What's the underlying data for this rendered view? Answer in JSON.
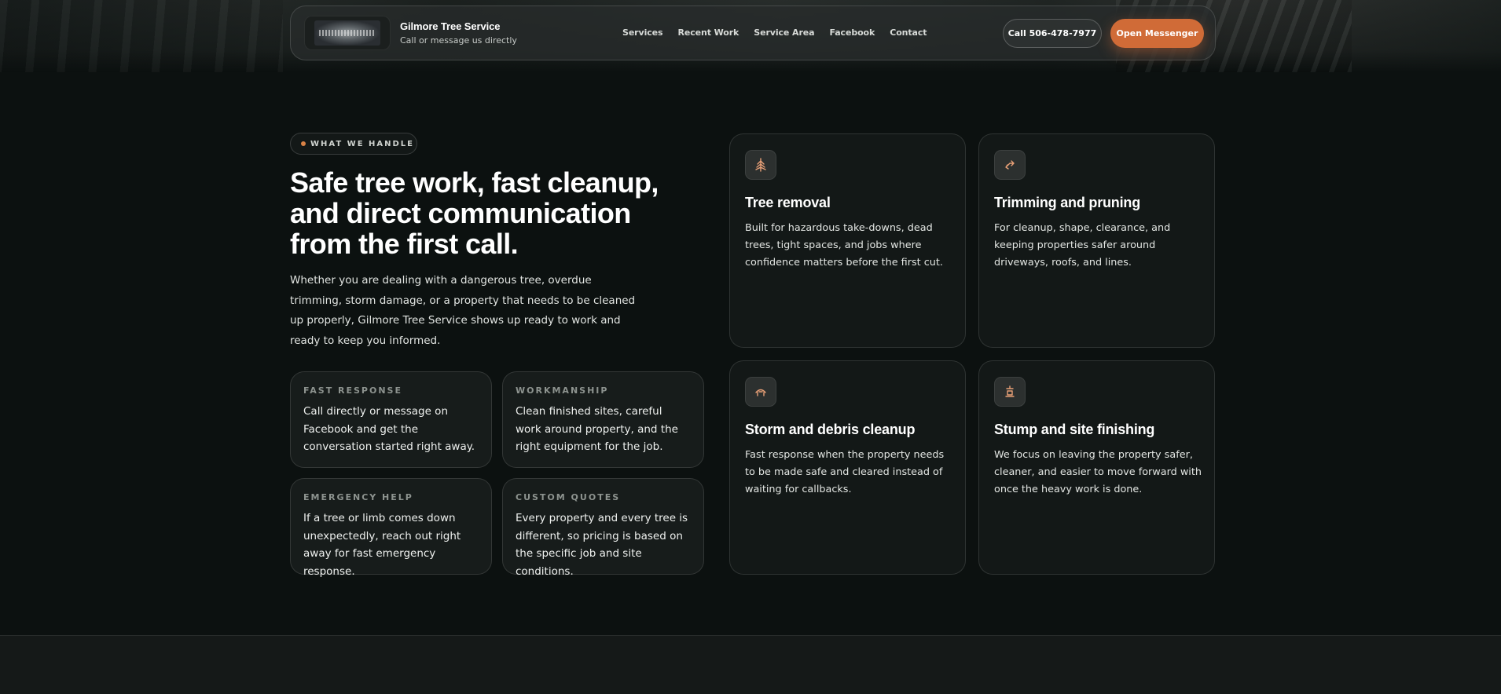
{
  "header": {
    "brand_name": "Gilmore Tree Service",
    "brand_subtitle": "Call or message us directly",
    "nav": [
      "Services",
      "Recent Work",
      "Service Area",
      "Facebook",
      "Contact"
    ],
    "call_button": "Call 506-478-7977",
    "messenger_button": "Open Messenger"
  },
  "section": {
    "eyebrow": "WHAT WE HANDLE",
    "headline": "Safe tree work, fast cleanup, and direct communication from the first call.",
    "lede": "Whether you are dealing with a dangerous tree, overdue trimming, storm damage, or a property that needs to be cleaned up properly, Gilmore Tree Service shows up ready to work and ready to keep you informed."
  },
  "features": [
    {
      "label": "FAST RESPONSE",
      "text": "Call directly or message on Facebook and get the conversation started right away."
    },
    {
      "label": "WORKMANSHIP",
      "text": "Clean finished sites, careful work around property, and the right equipment for the job."
    },
    {
      "label": "EMERGENCY HELP",
      "text": "If a tree or limb comes down unexpectedly, reach out right away for fast emergency response."
    },
    {
      "label": "CUSTOM QUOTES",
      "text": "Every property and every tree is different, so pricing is based on the specific job and site conditions."
    }
  ],
  "services": [
    {
      "icon": "tree-icon",
      "title": "Tree removal",
      "text": "Built for hazardous take-downs, dead trees, tight spaces, and jobs where confidence matters before the first cut."
    },
    {
      "icon": "pruning-icon",
      "title": "Trimming and pruning",
      "text": "For cleanup, shape, clearance, and keeping properties safer around driveways, roofs, and lines."
    },
    {
      "icon": "storm-icon",
      "title": "Storm and debris cleanup",
      "text": "Fast response when the property needs to be made safe and cleared instead of waiting for callbacks."
    },
    {
      "icon": "stump-icon",
      "title": "Stump and site finishing",
      "text": "We focus on leaving the property safer, cleaner, and easier to move forward with once the heavy work is done."
    }
  ],
  "colors": {
    "accent": "#d06b37",
    "background": "#0c1110",
    "card": "#131817"
  }
}
